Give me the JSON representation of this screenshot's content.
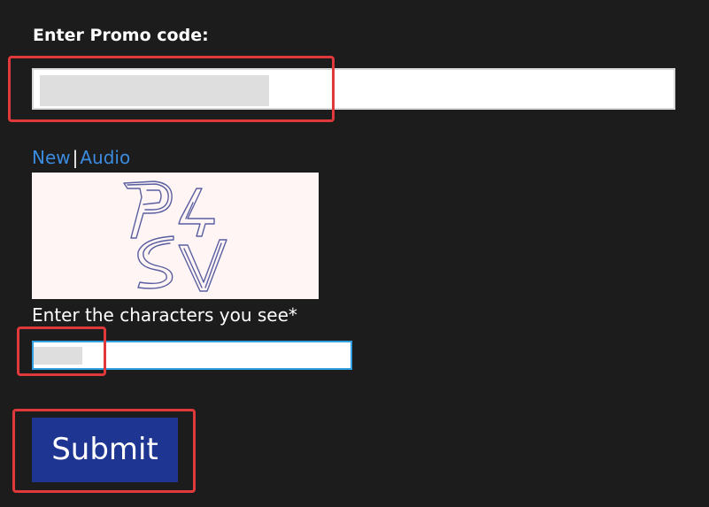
{
  "promo": {
    "label": "Enter Promo code:"
  },
  "captcha": {
    "new_link": "New",
    "separator": "|",
    "audio_link": "Audio",
    "image_text": "P4SV",
    "label": "Enter the characters you see*"
  },
  "submit": {
    "label": "Submit"
  },
  "colors": {
    "background": "#1c1c1c",
    "link": "#3b8bdf",
    "submit_button": "#1e3591",
    "highlight": "#e0393c",
    "input_focus_border": "#2f9fe0"
  }
}
